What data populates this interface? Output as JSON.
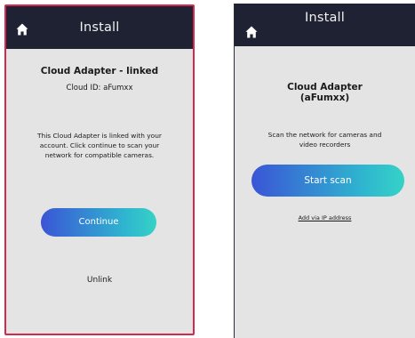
{
  "left": {
    "header_title": "Install",
    "heading": "Cloud Adapter - linked",
    "cloud_id": "Cloud ID: aFumxx",
    "description_lines": [
      "This Cloud Adapter is linked with your",
      "account. Click continue to scan your",
      "network for compatible cameras."
    ],
    "continue_label": "Continue",
    "unlink_label": "Unlink"
  },
  "right": {
    "header_title": "Install",
    "heading_line1": "Cloud Adapter",
    "heading_line2": "(aFumxx)",
    "description_lines": [
      "Scan the network for cameras and",
      "video recorders"
    ],
    "start_scan_label": "Start scan",
    "add_ip_label": "Add via IP address"
  },
  "icons": {
    "home": "home-icon"
  },
  "colors": {
    "header": "#1e2232",
    "accent_start": "#3a55d6",
    "accent_end": "#35d2c6",
    "highlight_border": "#d6284e"
  }
}
